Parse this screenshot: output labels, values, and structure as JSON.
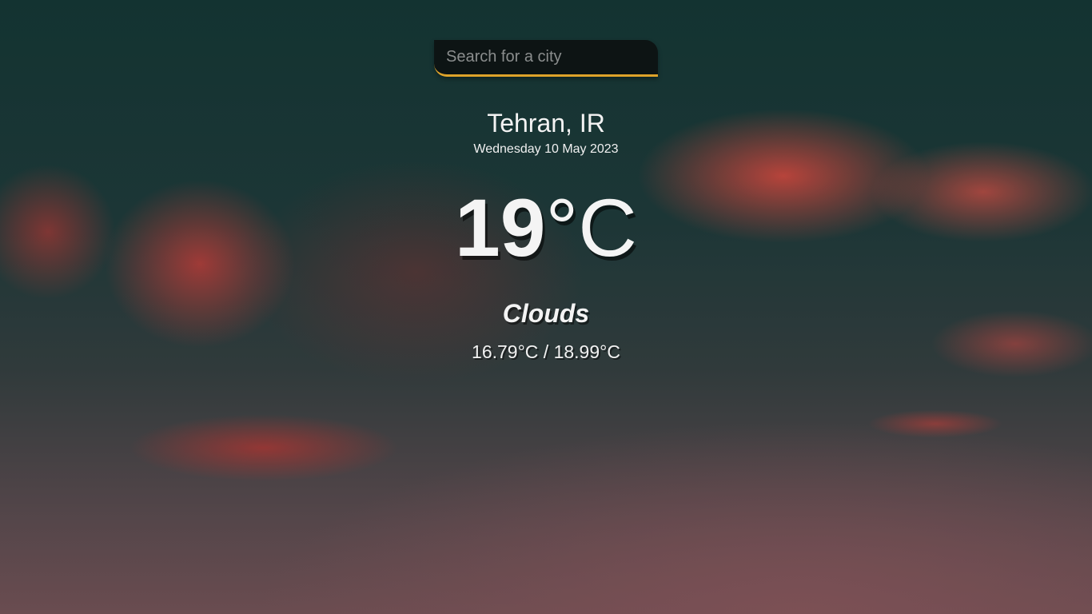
{
  "search": {
    "placeholder": "Search for a city",
    "value": "",
    "accent_color": "#dea32a"
  },
  "location": {
    "city": "Tehran, IR",
    "date": "Wednesday 10 May 2023"
  },
  "current": {
    "temp_value": "19",
    "temp_unit": "°C",
    "condition": "Clouds",
    "hi_low": "16.79°C / 18.99°C"
  }
}
